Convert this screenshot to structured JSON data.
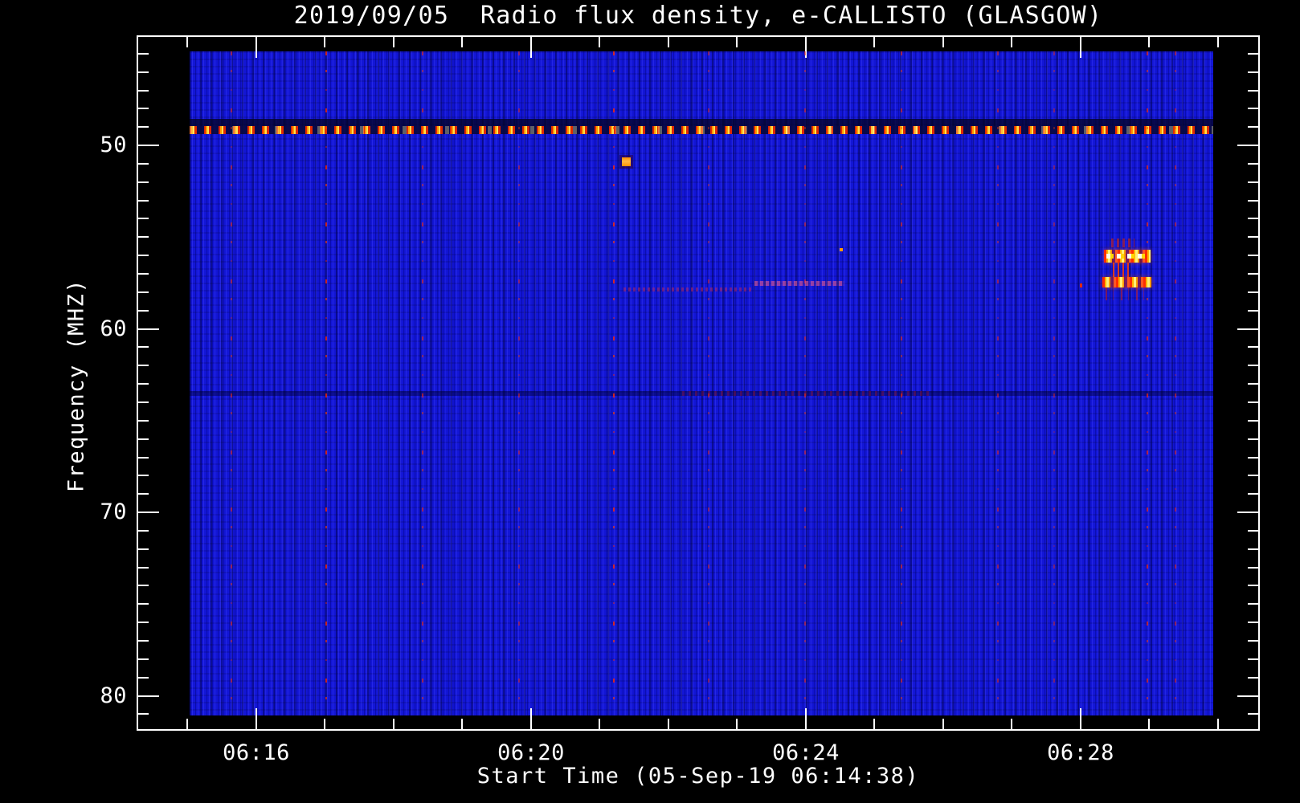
{
  "chart_data": {
    "type": "heatmap",
    "title": "2019/09/05  Radio flux density, e-CALLISTO (GLASGOW)",
    "xlabel": "Start Time (05-Sep-19 06:14:38)",
    "ylabel": "Frequency (MHZ)",
    "date": "2019/09/05",
    "instrument": "e-CALLISTO (GLASGOW)",
    "start_time": "06:14:38",
    "x_axis": {
      "unit": "minutes after 06:00 UT",
      "domain": [
        14.26,
        30.61
      ],
      "major_ticks": [
        {
          "t": 16,
          "label": "06:16"
        },
        {
          "t": 20,
          "label": "06:20"
        },
        {
          "t": 24,
          "label": "06:24"
        },
        {
          "t": 28,
          "label": "06:28"
        }
      ],
      "minor_ticks": [
        15,
        17,
        18,
        19,
        21,
        22,
        23,
        25,
        26,
        27,
        29,
        30
      ]
    },
    "y_axis": {
      "unit": "MHz",
      "direction": "increasing-downward",
      "domain": [
        44.0,
        81.9
      ],
      "major_ticks": [
        {
          "f": 50,
          "label": "50"
        },
        {
          "f": 60,
          "label": "60"
        },
        {
          "f": 70,
          "label": "70"
        },
        {
          "f": 80,
          "label": "80"
        }
      ],
      "minor_ticks": [
        45,
        46,
        47,
        48,
        49,
        51,
        52,
        53,
        54,
        55,
        56,
        57,
        58,
        59,
        61,
        62,
        63,
        64,
        65,
        66,
        67,
        68,
        69,
        71,
        72,
        73,
        74,
        75,
        76,
        77,
        78,
        79,
        81
      ]
    },
    "image_extent": {
      "t": [
        15.03,
        29.93
      ],
      "f": [
        44.88,
        81.07
      ]
    },
    "colors": {
      "background_blue": "#1316d6",
      "noise_dark_blue": "#0000a8",
      "noise_light_blue": "#2f2fff",
      "rfi_red": "#e02800",
      "rfi_orange": "#ff9a00",
      "rfi_yellow": "#ffdf4d",
      "axis": "#ffffff",
      "frame_background": "#000000"
    },
    "features": [
      {
        "kind": "hband",
        "cls": "dark-band",
        "name": "dark-notch-band",
        "t": [
          15.03,
          29.93
        ],
        "f": [
          48.55,
          48.95
        ]
      },
      {
        "kind": "hdash",
        "cls": "rfi-dash",
        "name": "rfi-dashed-line-49MHz",
        "t": [
          15.03,
          29.93
        ],
        "f": [
          48.95,
          49.38
        ]
      },
      {
        "kind": "hband",
        "cls": "dark-row",
        "name": "dark-row-63MHz",
        "t": [
          15.03,
          29.93
        ],
        "f": [
          63.39,
          63.65
        ]
      },
      {
        "kind": "hband",
        "cls": "dark-row-red",
        "name": "reddish-row-63MHz",
        "t": [
          22.2,
          25.8
        ],
        "f": [
          63.39,
          63.65
        ]
      },
      {
        "kind": "vlines",
        "name": "vertical-rfi-streaks",
        "times": [
          15.64,
          17.02,
          18.42,
          19.83,
          21.21,
          22.59,
          23.99,
          25.39,
          26.8,
          27.62,
          28.97,
          29.38
        ],
        "opacity": [
          0.55,
          0.8,
          0.6,
          0.5,
          0.85,
          0.5,
          0.55,
          0.6,
          0.55,
          0.45,
          0.7,
          0.55
        ]
      },
      {
        "kind": "hband",
        "cls": "streak-a",
        "name": "faint-drifting-streak",
        "t": [
          21.35,
          23.25
        ],
        "f": [
          57.74,
          57.96
        ]
      },
      {
        "kind": "hband",
        "cls": "streak-b",
        "name": "pink-drifting-streak",
        "t": [
          23.25,
          24.56
        ],
        "f": [
          57.39,
          57.65
        ]
      },
      {
        "kind": "hband",
        "cls": "blob",
        "name": "orange-point-burst",
        "t": [
          21.32,
          21.45
        ],
        "f": [
          50.65,
          51.13
        ]
      },
      {
        "kind": "hband",
        "cls": "burst-faint",
        "name": "burst-faint-top",
        "t": [
          28.45,
          28.79
        ],
        "f": [
          55.07,
          55.55
        ]
      },
      {
        "kind": "hband",
        "cls": "burst-band upper",
        "name": "burst-band-56MHz",
        "t": [
          28.34,
          29.02
        ],
        "f": [
          55.68,
          56.38
        ]
      },
      {
        "kind": "hband",
        "cls": "burst-connector",
        "name": "burst-connector",
        "t": [
          28.47,
          28.7
        ],
        "f": [
          56.38,
          57.17
        ]
      },
      {
        "kind": "hband",
        "cls": "burst-band lower",
        "name": "burst-band-57MHz",
        "t": [
          28.32,
          29.03
        ],
        "f": [
          57.17,
          57.74
        ]
      },
      {
        "kind": "hband",
        "cls": "speckles",
        "name": "burst-speckles-below",
        "t": [
          28.36,
          28.92
        ],
        "f": [
          57.74,
          58.44
        ]
      },
      {
        "kind": "hband",
        "cls": "dot-red",
        "name": "red-dot",
        "t": [
          27.99,
          28.03
        ],
        "f": [
          57.52,
          57.74
        ]
      },
      {
        "kind": "hband",
        "cls": "dot-orange",
        "name": "orange-dot",
        "t": [
          24.49,
          24.54
        ],
        "f": [
          55.6,
          55.77
        ]
      }
    ]
  }
}
